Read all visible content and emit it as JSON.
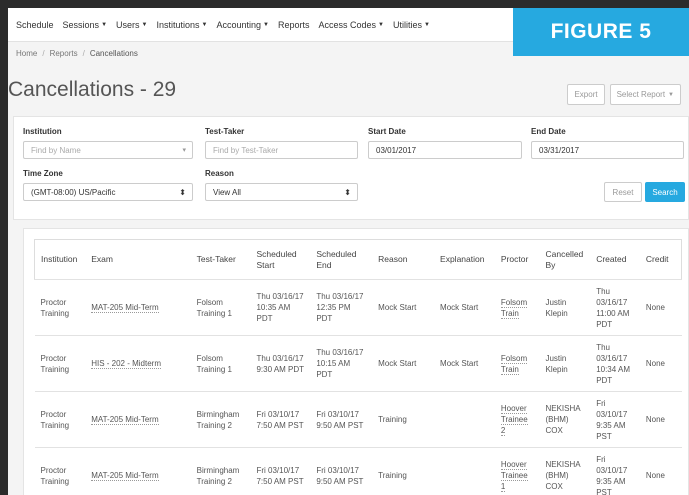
{
  "nav": {
    "items": [
      {
        "label": "Schedule",
        "dropdown": false
      },
      {
        "label": "Sessions",
        "dropdown": true
      },
      {
        "label": "Users",
        "dropdown": true
      },
      {
        "label": "Institutions",
        "dropdown": true
      },
      {
        "label": "Accounting",
        "dropdown": true
      },
      {
        "label": "Reports",
        "dropdown": false
      },
      {
        "label": "Access Codes",
        "dropdown": true
      },
      {
        "label": "Utilities",
        "dropdown": true
      }
    ]
  },
  "figure_label": "FIGURE 5",
  "breadcrumb": {
    "home": "Home",
    "reports": "Reports",
    "current": "Cancellations"
  },
  "page": {
    "title": "Cancellations - 29",
    "export_label": "Export",
    "select_report_label": "Select Report"
  },
  "filters": {
    "institution": {
      "label": "Institution",
      "placeholder": "Find by Name"
    },
    "test_taker": {
      "label": "Test-Taker",
      "placeholder": "Find by Test-Taker"
    },
    "start_date": {
      "label": "Start Date",
      "value": "03/01/2017"
    },
    "end_date": {
      "label": "End Date",
      "value": "03/31/2017"
    },
    "time_zone": {
      "label": "Time Zone",
      "value": "(GMT-08:00) US/Pacific"
    },
    "reason": {
      "label": "Reason",
      "value": "View All"
    },
    "reset_label": "Reset",
    "search_label": "Search"
  },
  "table": {
    "headers": {
      "institution": "Institution",
      "exam": "Exam",
      "test_taker": "Test-Taker",
      "scheduled_start": "Scheduled Start",
      "scheduled_end": "Scheduled End",
      "reason": "Reason",
      "explanation": "Explanation",
      "proctor": "Proctor",
      "cancelled_by": "Cancelled By",
      "created": "Created",
      "credit": "Credit"
    },
    "rows": [
      {
        "institution": "Proctor Training",
        "exam": "MAT-205 Mid-Term",
        "test_taker": "Folsom Training 1",
        "scheduled_start": "Thu 03/16/17 10:35 AM PDT",
        "scheduled_end": "Thu 03/16/17 12:35 PM PDT",
        "reason": "Mock Start",
        "explanation": "Mock Start",
        "proctor": "Folsom Train",
        "cancelled_by": "Justin Klepin",
        "created": "Thu 03/16/17 11:00 AM PDT",
        "credit": "None"
      },
      {
        "institution": "Proctor Training",
        "exam": "HIS - 202 - Midterm",
        "test_taker": "Folsom Training 1",
        "scheduled_start": "Thu 03/16/17 9:30 AM PDT",
        "scheduled_end": "Thu 03/16/17 10:15 AM PDT",
        "reason": "Mock Start",
        "explanation": "Mock Start",
        "proctor": "Folsom Train",
        "cancelled_by": "Justin Klepin",
        "created": "Thu 03/16/17 10:34 AM PDT",
        "credit": "None"
      },
      {
        "institution": "Proctor Training",
        "exam": "MAT-205 Mid-Term",
        "test_taker": "Birmingham Training 2",
        "scheduled_start": "Fri 03/10/17 7:50 AM PST",
        "scheduled_end": "Fri 03/10/17 9:50 AM PST",
        "reason": "Training",
        "explanation": "",
        "proctor": "Hoover Trainee 2",
        "cancelled_by": "NEKISHA (BHM) COX",
        "created": "Fri 03/10/17 9:35 AM PST",
        "credit": "None"
      },
      {
        "institution": "Proctor Training",
        "exam": "MAT-205 Mid-Term",
        "test_taker": "Birmingham Training 2",
        "scheduled_start": "Fri 03/10/17 7:50 AM PST",
        "scheduled_end": "Fri 03/10/17 9:50 AM PST",
        "reason": "Training",
        "explanation": "",
        "proctor": "Hoover Trainee 1",
        "cancelled_by": "NEKISHA (BHM) COX",
        "created": "Fri 03/10/17 9:35 AM PST",
        "credit": "None"
      }
    ]
  },
  "colors": {
    "accent": "#26a9e0",
    "background": "#f4f4f4",
    "frame": "#2b2b2b"
  }
}
